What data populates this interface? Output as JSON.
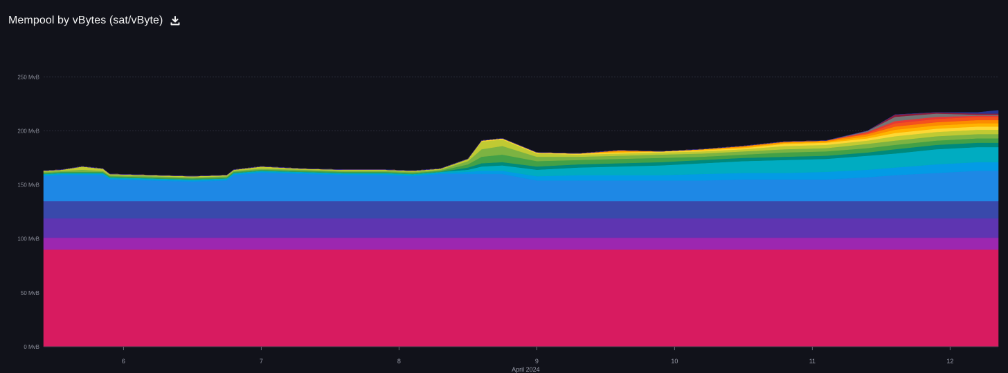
{
  "header": {
    "title": "Mempool by vBytes (sat/vByte)",
    "download_icon": "download-icon"
  },
  "chart_data": {
    "type": "area",
    "stacked": true,
    "title": "Mempool by vBytes (sat/vByte)",
    "xlabel": "April 2024",
    "ylabel": "",
    "y_unit": "MvB",
    "ylim": [
      0,
      270
    ],
    "xlim": [
      5.42,
      12.35
    ],
    "x_ticks": [
      6,
      7,
      8,
      9,
      10,
      11,
      12
    ],
    "x_tick_labels": [
      "6",
      "7",
      "8",
      "9",
      "10",
      "11",
      "12"
    ],
    "y_ticks": [
      0,
      50,
      100,
      150,
      200,
      250
    ],
    "y_tick_labels": [
      "0 MvB",
      "50 MvB",
      "100 MvB",
      "150 MvB",
      "200 MvB",
      "250 MvB"
    ],
    "grid": true,
    "legend": "none",
    "x": [
      5.42,
      5.55,
      5.7,
      5.85,
      5.9,
      6.2,
      6.5,
      6.75,
      6.8,
      7.0,
      7.3,
      7.6,
      7.9,
      8.1,
      8.3,
      8.5,
      8.6,
      8.75,
      9.0,
      9.3,
      9.6,
      9.9,
      10.2,
      10.5,
      10.8,
      11.1,
      11.4,
      11.6,
      11.9,
      12.2,
      12.35
    ],
    "series": [
      {
        "color": "#d81b60",
        "values": [
          90,
          90,
          90,
          90,
          90,
          90,
          90,
          90,
          90,
          90,
          90,
          90,
          90,
          90,
          90,
          90,
          90,
          90,
          90,
          90,
          90,
          90,
          90,
          90,
          90,
          90,
          90,
          90,
          90,
          90,
          90
        ]
      },
      {
        "color": "#9c27b0",
        "values": [
          11,
          11,
          11,
          11,
          11,
          11,
          11,
          11,
          11,
          11,
          11,
          11,
          11,
          11,
          11,
          11,
          11,
          11,
          11,
          11,
          11,
          11,
          11,
          11,
          11,
          11,
          11,
          11,
          11,
          11,
          11
        ]
      },
      {
        "color": "#5e35b1",
        "values": [
          18,
          18,
          18,
          18,
          18,
          18,
          18,
          18,
          18,
          18,
          18,
          18,
          18,
          18,
          18,
          18,
          18,
          18,
          18,
          18,
          18,
          18,
          18,
          18,
          18,
          18,
          18,
          18,
          18,
          18,
          18
        ]
      },
      {
        "color": "#3949ab",
        "values": [
          16,
          16,
          16,
          16,
          16,
          16,
          16,
          16,
          16,
          16,
          16,
          16,
          16,
          16,
          16,
          16,
          16,
          16,
          16,
          16,
          16,
          16,
          16,
          16,
          16,
          16,
          16,
          16,
          16,
          16,
          16
        ]
      },
      {
        "color": "#1e88e5",
        "values": [
          23,
          24,
          24,
          24,
          20,
          19,
          18,
          19,
          24,
          26,
          25,
          24,
          24,
          23,
          25,
          25,
          25,
          25,
          19,
          19,
          19,
          19,
          19,
          20,
          20,
          20,
          22,
          24,
          26,
          28,
          28
        ]
      },
      {
        "color": "#039be5",
        "values": [
          1,
          1,
          1,
          1,
          1,
          1,
          1,
          1,
          1,
          1,
          1,
          1,
          1,
          1,
          1,
          2,
          3,
          3,
          4,
          5,
          5,
          5,
          6,
          6,
          6,
          7,
          7,
          7,
          8,
          8,
          8
        ]
      },
      {
        "color": "#00acc1",
        "values": [
          1,
          1,
          1,
          1,
          1,
          1,
          1,
          1,
          1,
          1,
          1,
          1,
          1,
          1,
          1,
          2,
          4,
          5,
          6,
          7,
          8,
          9,
          10,
          11,
          12,
          12,
          13,
          13,
          14,
          14,
          14
        ]
      },
      {
        "color": "#00897b",
        "values": [
          0,
          0,
          0,
          0,
          0,
          0,
          0,
          0,
          0,
          0,
          0,
          0,
          0,
          0,
          0,
          2,
          3,
          3,
          3,
          3,
          3,
          3,
          3,
          3,
          3,
          3,
          3,
          4,
          4,
          4,
          4
        ]
      },
      {
        "color": "#43a047",
        "values": [
          1,
          1,
          1,
          1,
          1,
          1,
          1,
          1,
          1,
          1,
          1,
          1,
          1,
          1,
          1,
          3,
          6,
          7,
          5,
          4,
          4,
          4,
          3,
          3,
          4,
          4,
          4,
          4,
          4,
          4,
          4
        ]
      },
      {
        "color": "#7cb342",
        "values": [
          1,
          1,
          2,
          1,
          1,
          1,
          1,
          1,
          1,
          1,
          1,
          1,
          1,
          1,
          1,
          3,
          7,
          8,
          4,
          3,
          3,
          3,
          3,
          3,
          3,
          3,
          4,
          4,
          4,
          4,
          4
        ]
      },
      {
        "color": "#c0ca33",
        "values": [
          1,
          1,
          3,
          2,
          1,
          1,
          1,
          1,
          1,
          2,
          1,
          1,
          1,
          1,
          1,
          2,
          7,
          6,
          3,
          2,
          2,
          2,
          2,
          2,
          3,
          3,
          3,
          4,
          4,
          4,
          4
        ]
      },
      {
        "color": "#fdd835",
        "values": [
          0,
          0,
          0,
          0,
          0,
          0,
          0,
          0,
          0,
          0,
          0,
          0,
          0,
          0,
          0,
          0,
          1,
          1,
          1,
          1,
          1,
          1,
          1,
          1,
          2,
          2,
          2,
          3,
          3,
          3,
          3
        ]
      },
      {
        "color": "#ffb300",
        "values": [
          0,
          0,
          0,
          0,
          0,
          0,
          0,
          0,
          0,
          0,
          0,
          0,
          0,
          0,
          0,
          0,
          0,
          0,
          0,
          0,
          1,
          0,
          1,
          1,
          1,
          1,
          2,
          3,
          3,
          3,
          3
        ]
      },
      {
        "color": "#fb8c00",
        "values": [
          0,
          0,
          0,
          0,
          0,
          0,
          0,
          0,
          0,
          0,
          0,
          0,
          0,
          0,
          0,
          0,
          0,
          0,
          0,
          0,
          1,
          0,
          0,
          1,
          1,
          1,
          2,
          3,
          3,
          3,
          3
        ]
      },
      {
        "color": "#f4511e",
        "values": [
          0,
          0,
          0,
          0,
          0,
          0,
          0,
          0,
          0,
          0,
          0,
          0,
          0,
          0,
          0,
          0,
          0,
          0,
          0,
          0,
          0,
          0,
          0,
          0,
          0,
          0,
          1,
          3,
          3,
          3,
          3
        ]
      },
      {
        "color": "#e53935",
        "values": [
          0,
          0,
          0,
          0,
          0,
          0,
          0,
          0,
          0,
          0,
          0,
          0,
          0,
          0,
          0,
          0,
          0,
          0,
          0,
          0,
          0,
          0,
          0,
          0,
          0,
          0,
          1,
          2,
          2,
          1,
          1
        ]
      },
      {
        "color": "#757575",
        "values": [
          0,
          0,
          0,
          0,
          0,
          0,
          0,
          0,
          0,
          0,
          0,
          0,
          0,
          0,
          0,
          0,
          0,
          0,
          0,
          0,
          0,
          0,
          0,
          0,
          0,
          0,
          1,
          4,
          3,
          1,
          1
        ]
      },
      {
        "color": "#8e1b3a",
        "values": [
          0,
          0,
          0,
          0,
          0,
          0,
          0,
          0,
          0,
          0,
          0,
          0,
          0,
          0,
          0,
          0,
          0,
          0,
          0,
          0,
          0,
          0,
          0,
          0,
          0,
          0,
          0,
          2,
          1,
          1,
          1
        ]
      },
      {
        "color": "#283593",
        "values": [
          0,
          0,
          0,
          0,
          0,
          0,
          0,
          0,
          0,
          0,
          0,
          0,
          0,
          0,
          0,
          0,
          0,
          0,
          0,
          0,
          0,
          0,
          0,
          0,
          0,
          0,
          0,
          0,
          0,
          1,
          3
        ]
      }
    ]
  }
}
